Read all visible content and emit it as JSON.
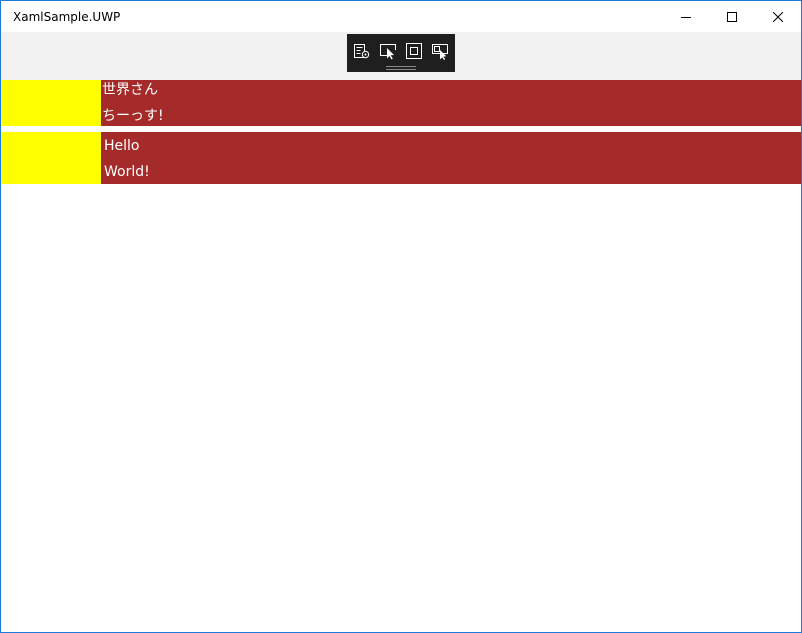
{
  "window": {
    "title": "XamlSample.UWP"
  },
  "caption_buttons": {
    "minimize_icon": "minimize-icon",
    "maximize_icon": "maximize-icon",
    "close_icon": "close-icon"
  },
  "live_toolbar": {
    "tools": [
      {
        "icon": "live-visual-tree-icon"
      },
      {
        "icon": "select-element-icon"
      },
      {
        "icon": "display-layout-adorners-icon"
      },
      {
        "icon": "track-focus-icon"
      }
    ]
  },
  "rows": [
    {
      "line1": "世界さん",
      "line2": "ちーっす!"
    },
    {
      "line1": "Hello",
      "line2": "World!"
    }
  ],
  "colors": {
    "accent_border": "#1e7ad6",
    "yellow": "#ffff00",
    "brown_red": "#a52a2a",
    "toolbar_bg": "#1f1f1f",
    "band_bg": "#f2f2f2"
  }
}
